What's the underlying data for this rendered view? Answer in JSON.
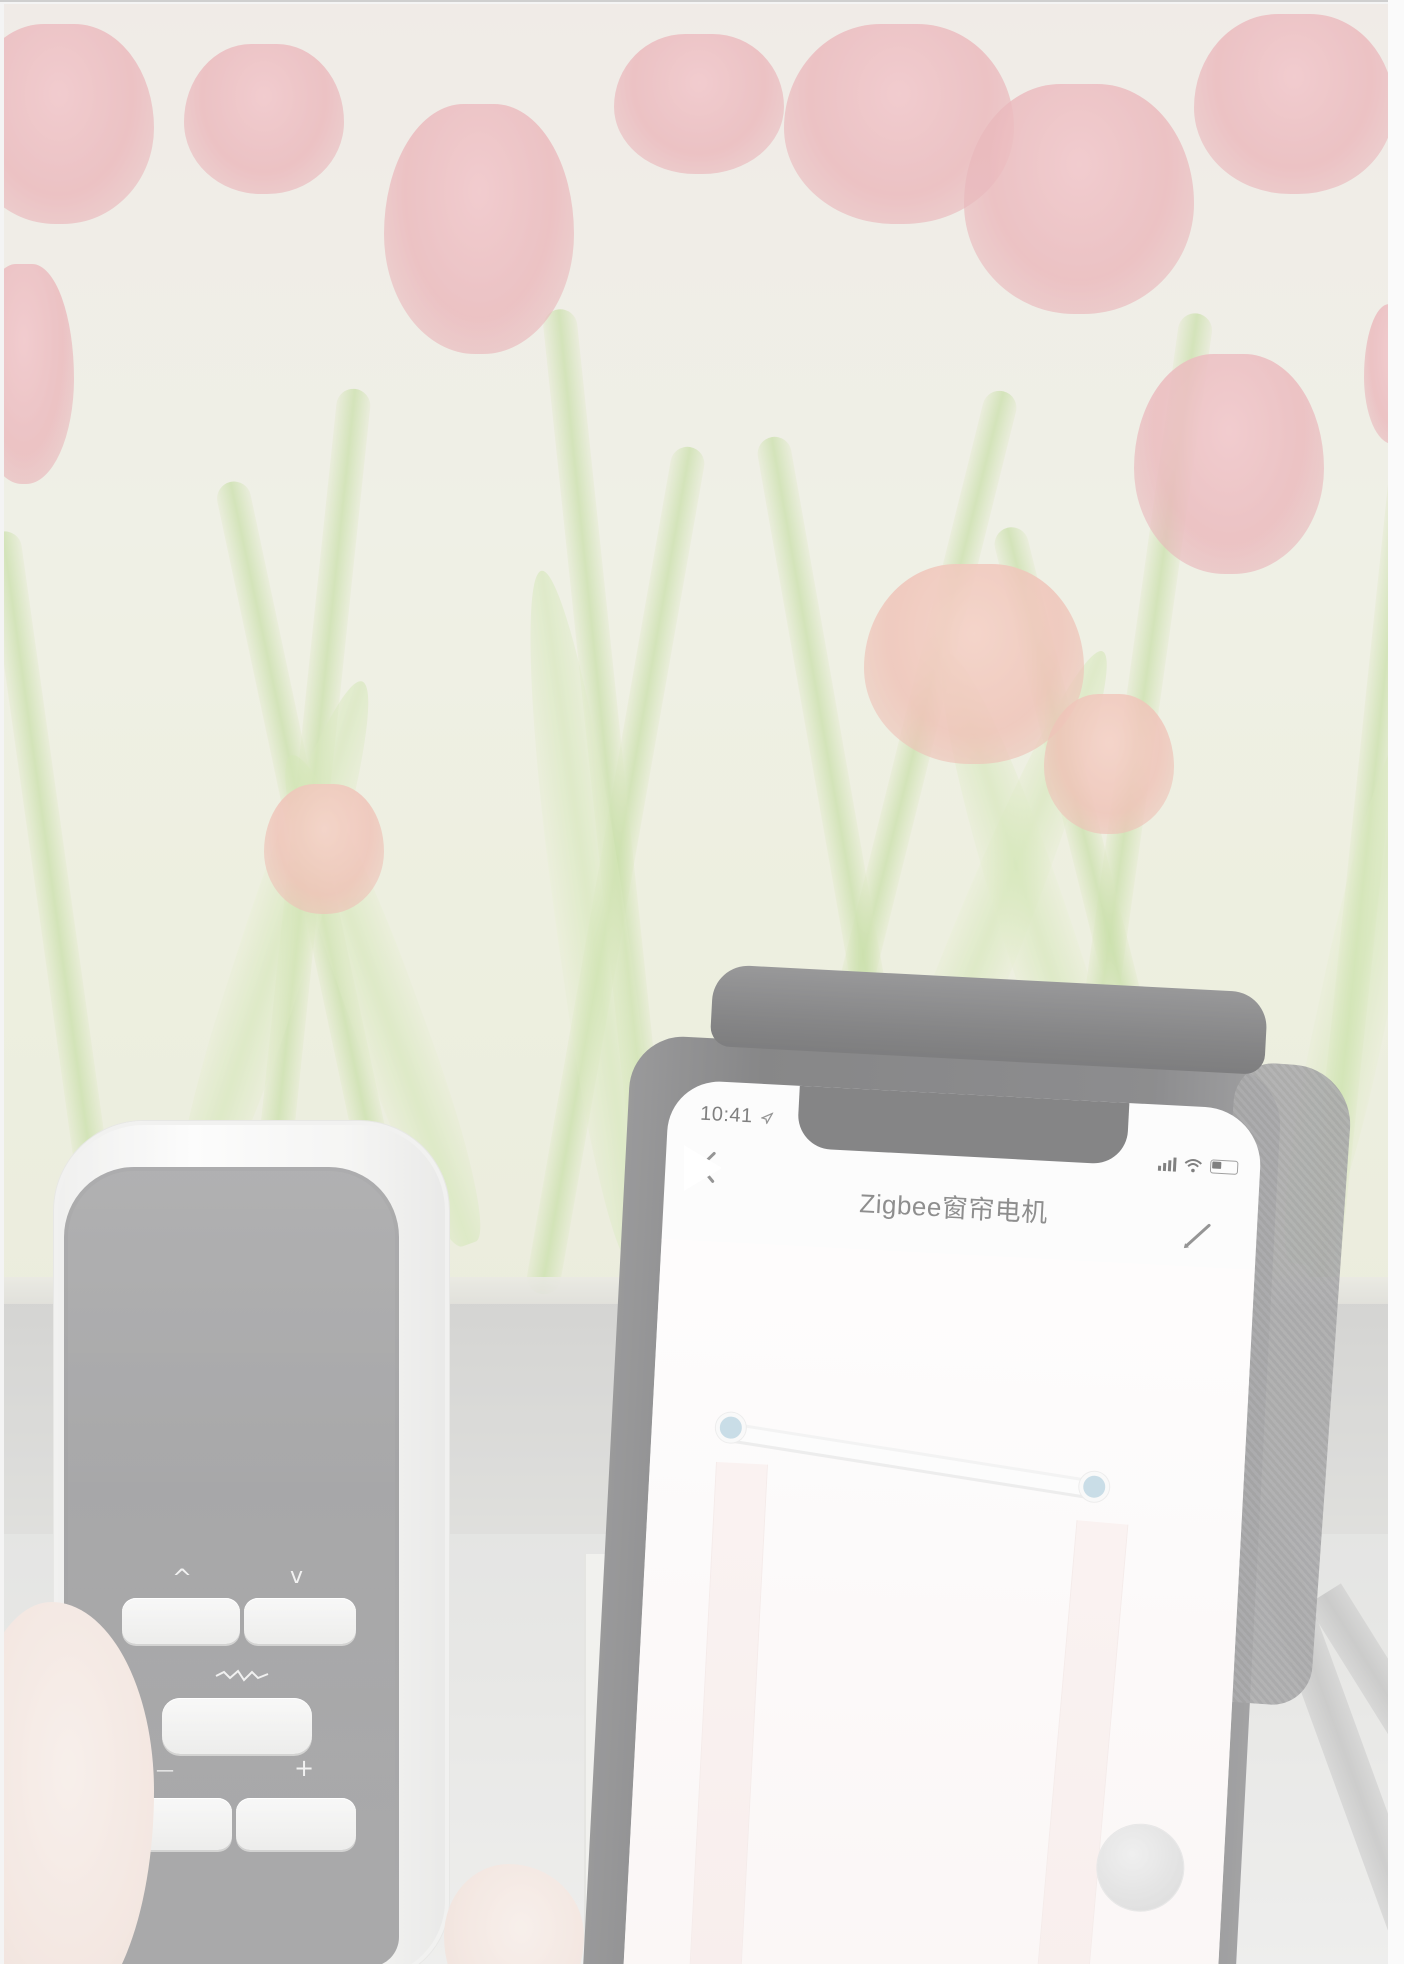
{
  "video": {
    "play_icon": "play-icon",
    "accent": "#ffffff"
  },
  "phone": {
    "status_time": "10:41",
    "location_icon": "location-arrow-icon",
    "signal_icon": "cellular-signal-icon",
    "wifi_icon": "wifi-icon",
    "battery_icon": "battery-icon",
    "nav": {
      "back_icon": "chevron-left-icon",
      "title": "Zigbee窗帘电机",
      "edit_icon": "pencil-icon"
    },
    "curtain": {
      "rail_color": "#f2f2f2",
      "dot_color": "#a8c9d9",
      "panel_color": "#f4e4e2"
    }
  },
  "remote": {
    "up_glyph": "^",
    "down_glyph": "v",
    "stop_icon": "wave-icon",
    "minus_glyph": "—",
    "plus_glyph": "+"
  }
}
